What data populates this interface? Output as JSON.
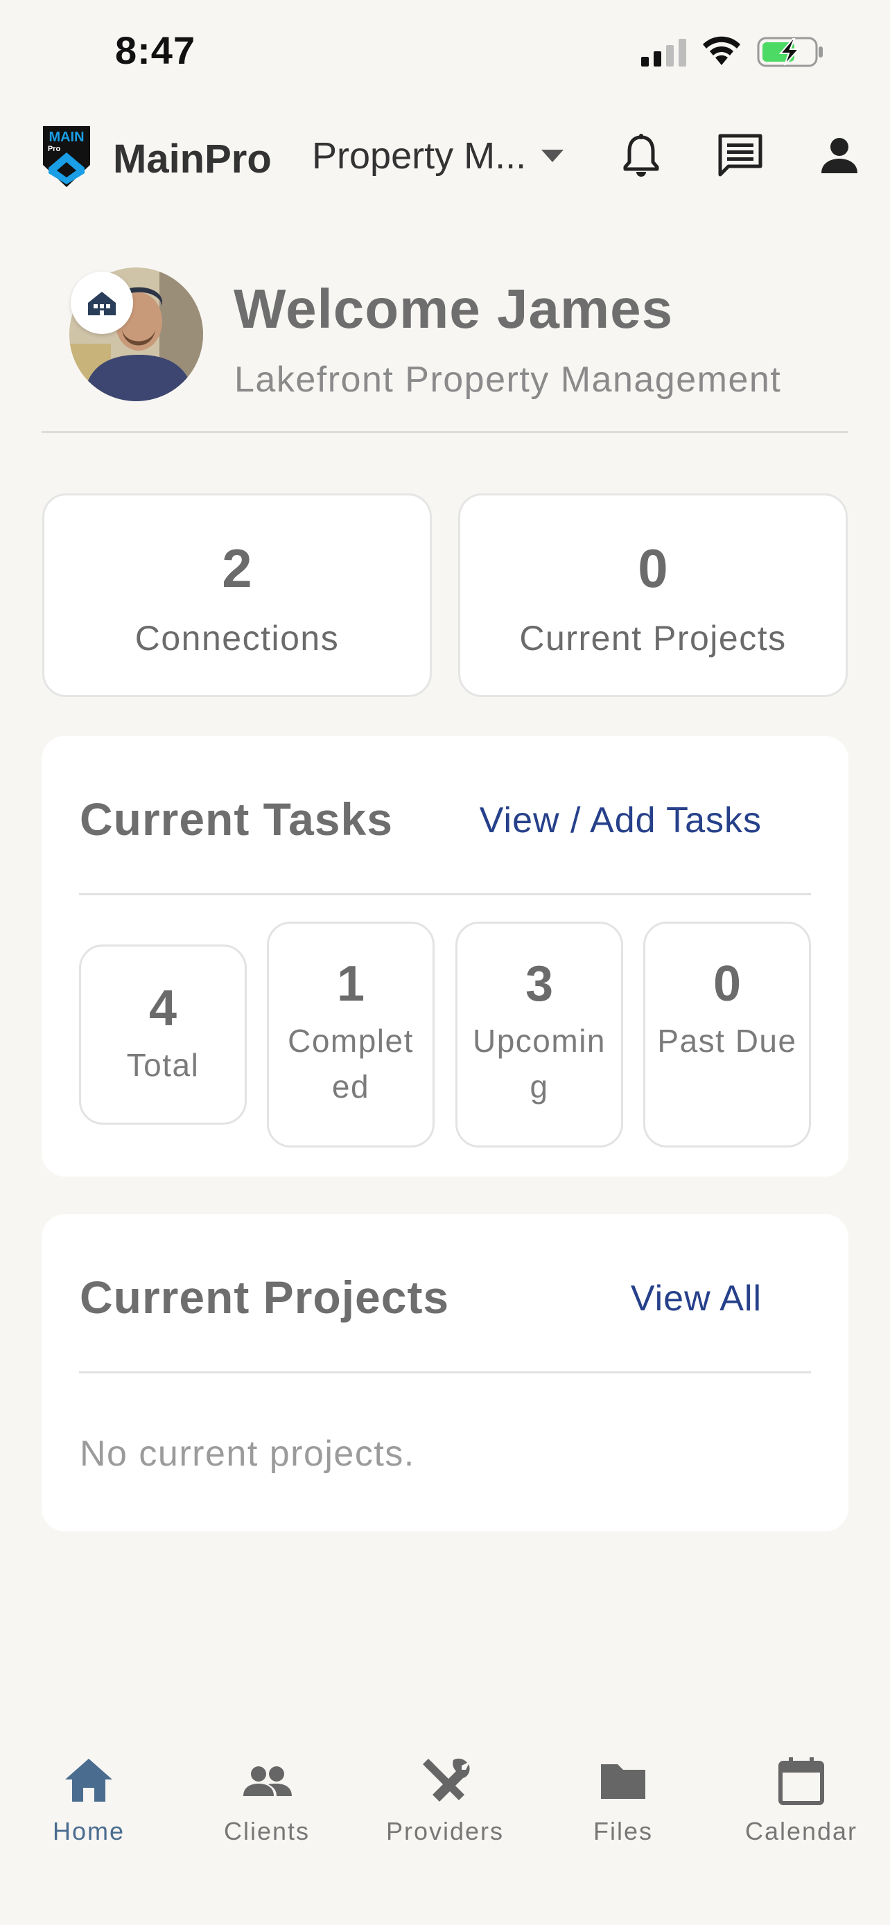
{
  "status_bar": {
    "time": "8:47"
  },
  "header": {
    "brand": "MainPro",
    "logo_text": "MAIN",
    "logo_subtext": "Pro",
    "company_selector_label": "Property M...",
    "icons": [
      "bell-icon",
      "chat-icon",
      "person-icon"
    ]
  },
  "welcome": {
    "title": "Welcome James",
    "subtitle": "Lakefront Property Management"
  },
  "stats": [
    {
      "value": "2",
      "label": "Connections"
    },
    {
      "value": "0",
      "label": "Current Projects"
    }
  ],
  "tasks": {
    "title": "Current Tasks",
    "link": "View / Add Tasks",
    "tiles": [
      {
        "value": "4",
        "label": "Total"
      },
      {
        "value": "1",
        "label": "Completed"
      },
      {
        "value": "3",
        "label": "Upcoming"
      },
      {
        "value": "0",
        "label": "Past Due"
      }
    ]
  },
  "projects": {
    "title": "Current Projects",
    "link": "View All",
    "empty": "No current projects."
  },
  "nav": [
    {
      "label": "Home",
      "icon": "home-icon",
      "active": true
    },
    {
      "label": "Clients",
      "icon": "people-icon",
      "active": false
    },
    {
      "label": "Providers",
      "icon": "tools-icon",
      "active": false
    },
    {
      "label": "Files",
      "icon": "folder-icon",
      "active": false
    },
    {
      "label": "Calendar",
      "icon": "calendar-icon",
      "active": false
    }
  ],
  "colors": {
    "background": "#f7f6f3",
    "link": "#26408a",
    "active_nav": "#4a6c8f",
    "logo_blue": "#1a9ee6",
    "battery_green": "#4cd964"
  }
}
